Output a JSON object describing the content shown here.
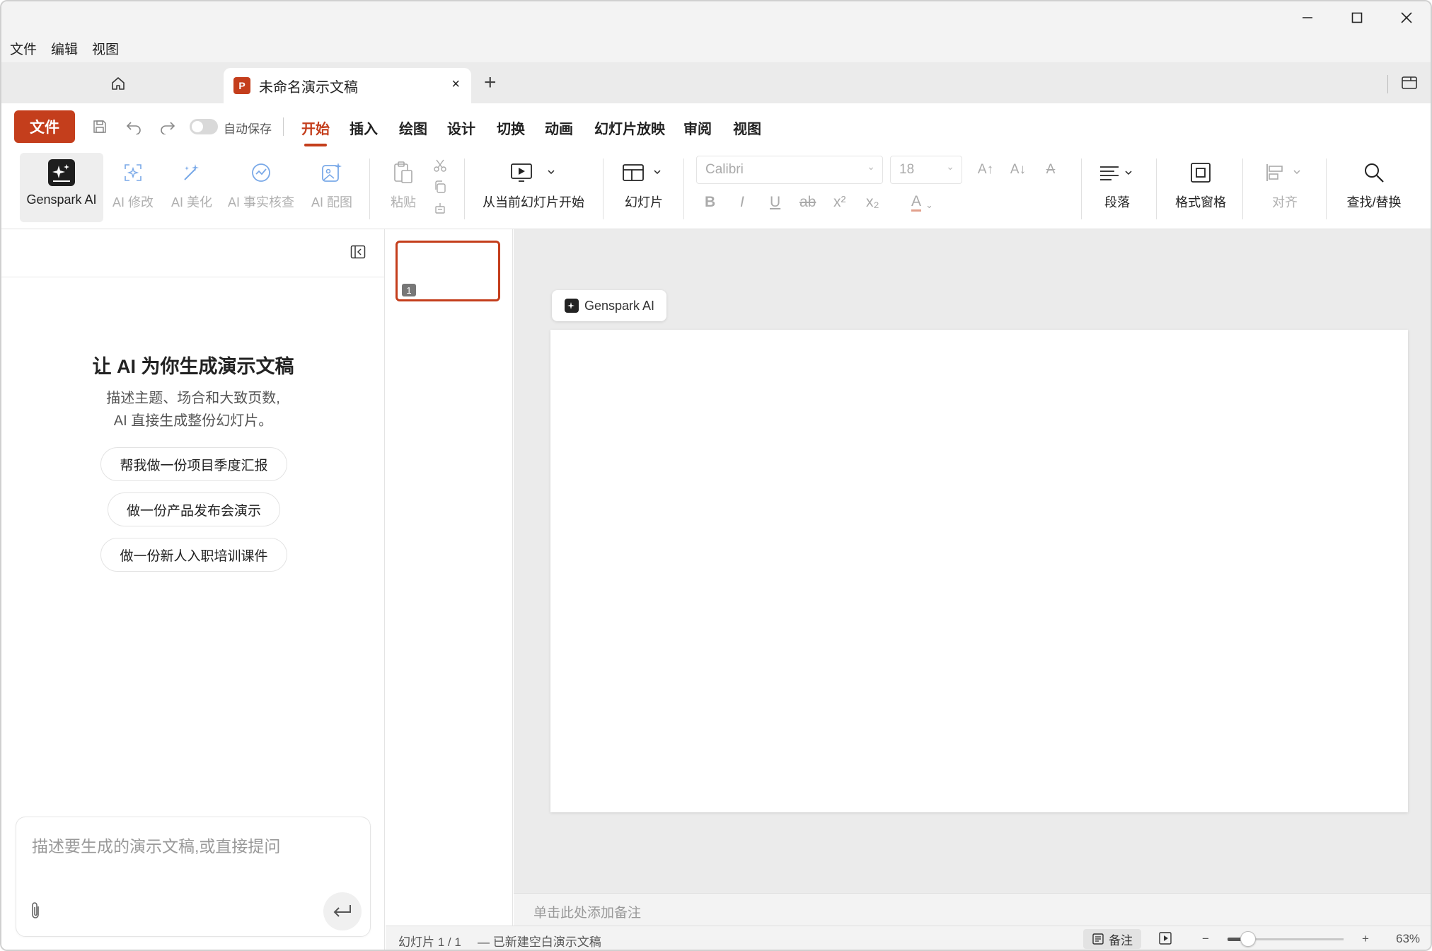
{
  "menubar": {
    "items": [
      "文件",
      "编辑",
      "视图"
    ]
  },
  "tabs": {
    "doc_title": "未命名演示文稿",
    "doc_badge": "P",
    "close_glyph": "×",
    "new_tab_glyph": "+"
  },
  "quick_access": {
    "file_button": "文件",
    "autosave_label": "自动保存",
    "autosave_on": false
  },
  "ribbon_tabs": [
    {
      "label": "开始",
      "active": true
    },
    {
      "label": "插入",
      "active": false
    },
    {
      "label": "绘图",
      "active": false
    },
    {
      "label": "设计",
      "active": false
    },
    {
      "label": "切换",
      "active": false
    },
    {
      "label": "动画",
      "active": false
    },
    {
      "label": "幻灯片放映",
      "active": false
    },
    {
      "label": "审阅",
      "active": false
    },
    {
      "label": "视图",
      "active": false
    }
  ],
  "ribbon": {
    "genspark_ai": "Genspark AI",
    "ai_edit": "AI 修改",
    "ai_beautify": "AI 美化",
    "ai_factcheck": "AI 事实核查",
    "ai_image": "AI 配图",
    "paste": "粘贴",
    "start_from_current": "从当前幻灯片开始",
    "slide": "幻灯片",
    "font_name": "Calibri",
    "font_size": "18",
    "paragraph": "段落",
    "format_pane": "格式窗格",
    "align": "对齐",
    "find_replace": "查找/替换",
    "fmt_bold": "B",
    "fmt_italic": "I",
    "fmt_underline": "U",
    "fmt_strike": "ab",
    "fmt_superscript": "x²",
    "fmt_subscript": "x₂",
    "fmt_fontcolor": "A",
    "grow_font": "A↑",
    "shrink_font": "A↓",
    "clear_format": "A"
  },
  "ai_panel": {
    "title": "让 AI 为你生成演示文稿",
    "subtitle_line1": "描述主题、场合和大致页数,",
    "subtitle_line2": "AI 直接生成整份幻灯片。",
    "suggestions": [
      "帮我做一份项目季度汇报",
      "做一份产品发布会演示",
      "做一份新人入职培训课件"
    ],
    "input_placeholder": "描述要生成的演示文稿,或直接提问"
  },
  "thumbnails": {
    "first_number": "1"
  },
  "editor": {
    "genspark_badge": "Genspark AI"
  },
  "notes": {
    "placeholder": "单击此处添加备注"
  },
  "statusbar": {
    "slide_counter": "幻灯片 1 / 1",
    "status_message": "— 已新建空白演示文稿",
    "notes_button": "备注",
    "zoom_minus": "−",
    "zoom_plus": "+",
    "zoom_level": "63%",
    "zoom_fraction": 0.63
  },
  "colors": {
    "accent": "#c43e1c",
    "chrome_bg": "#f3f3f3",
    "canvas_bg": "#ebebeb"
  }
}
